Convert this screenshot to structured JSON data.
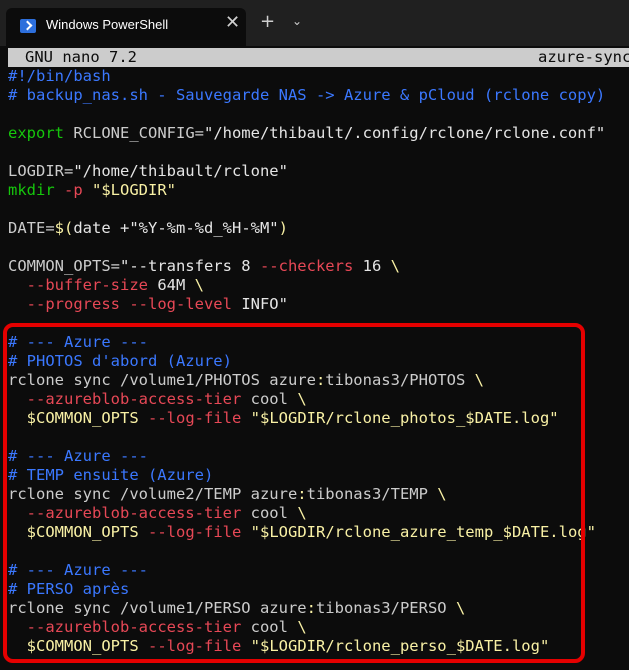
{
  "window": {
    "tab_title": "Windows PowerShell",
    "tab_close": "✕",
    "new_tab": "+",
    "dropdown": "⌄"
  },
  "nano": {
    "app_version": "GNU nano 7.2",
    "file_name": "azure-sync"
  },
  "code_lines": [
    [
      {
        "t": "#!/bin/bash",
        "c": "cmt"
      }
    ],
    [
      {
        "t": "# backup_nas.sh - Sauvegarde NAS -> Azure & pCloud (rclone copy)",
        "c": "cmt"
      }
    ],
    [],
    [
      {
        "t": "export",
        "c": "kw"
      },
      {
        "t": " RCLONE_CONFIG=",
        "c": "plain"
      },
      {
        "t": "\"/home/thibault/.config/rclone/rclone.conf\"",
        "c": "str"
      }
    ],
    [],
    [
      {
        "t": "LOGDIR=",
        "c": "plain"
      },
      {
        "t": "\"/home/thibault/rclone\"",
        "c": "str"
      }
    ],
    [
      {
        "t": "mkdir",
        "c": "kw"
      },
      {
        "t": " ",
        "c": "plain"
      },
      {
        "t": "-p",
        "c": "flag"
      },
      {
        "t": " \"$LOGDIR\"",
        "c": "var"
      }
    ],
    [],
    [
      {
        "t": "DATE=",
        "c": "plain"
      },
      {
        "t": "$(",
        "c": "op"
      },
      {
        "t": "date +\"%Y-%m-%d_%H-%M\"",
        "c": "str"
      },
      {
        "t": ")",
        "c": "op"
      }
    ],
    [],
    [
      {
        "t": "COMMON_OPTS=",
        "c": "plain"
      },
      {
        "t": "\"--transfers 8 ",
        "c": "str"
      },
      {
        "t": "--checkers",
        "c": "flag"
      },
      {
        "t": " 16 ",
        "c": "str"
      },
      {
        "t": "\\",
        "c": "var"
      }
    ],
    [
      {
        "t": "  ",
        "c": "plain"
      },
      {
        "t": "--buffer-size",
        "c": "flag"
      },
      {
        "t": " 64M ",
        "c": "str"
      },
      {
        "t": "\\",
        "c": "var"
      }
    ],
    [
      {
        "t": "  ",
        "c": "plain"
      },
      {
        "t": "--progress --log-level",
        "c": "flag"
      },
      {
        "t": " INFO\"",
        "c": "str"
      }
    ],
    [],
    [
      {
        "t": "# --- Azure ---",
        "c": "cmt"
      }
    ],
    [
      {
        "t": "# PHOTOS d'abord (Azure)",
        "c": "cmt"
      }
    ],
    [
      {
        "t": "rclone sync /volume1/PHOTOS azure",
        "c": "plain"
      },
      {
        "t": ":",
        "c": "var"
      },
      {
        "t": "tibonas3/PHOTOS ",
        "c": "plain"
      },
      {
        "t": "\\",
        "c": "var"
      }
    ],
    [
      {
        "t": "  ",
        "c": "plain"
      },
      {
        "t": "--azureblob-access-tier",
        "c": "flag"
      },
      {
        "t": " cool ",
        "c": "plain"
      },
      {
        "t": "\\",
        "c": "var"
      }
    ],
    [
      {
        "t": "  ",
        "c": "plain"
      },
      {
        "t": "$COMMON_OPTS",
        "c": "var"
      },
      {
        "t": " ",
        "c": "plain"
      },
      {
        "t": "--log-file",
        "c": "flag"
      },
      {
        "t": " \"$LOGDIR/rclone_photos_$DATE.log\"",
        "c": "var"
      }
    ],
    [],
    [
      {
        "t": "# --- Azure ---",
        "c": "cmt"
      }
    ],
    [
      {
        "t": "# TEMP ensuite (Azure)",
        "c": "cmt"
      }
    ],
    [
      {
        "t": "rclone sync /volume2/TEMP azure",
        "c": "plain"
      },
      {
        "t": ":",
        "c": "var"
      },
      {
        "t": "tibonas3/TEMP ",
        "c": "plain"
      },
      {
        "t": "\\",
        "c": "var"
      }
    ],
    [
      {
        "t": "  ",
        "c": "plain"
      },
      {
        "t": "--azureblob-access-tier",
        "c": "flag"
      },
      {
        "t": " cool ",
        "c": "plain"
      },
      {
        "t": "\\",
        "c": "var"
      }
    ],
    [
      {
        "t": "  ",
        "c": "plain"
      },
      {
        "t": "$COMMON_OPTS",
        "c": "var"
      },
      {
        "t": " ",
        "c": "plain"
      },
      {
        "t": "--log-file",
        "c": "flag"
      },
      {
        "t": " \"$LOGDIR/rclone_azure_temp_$DATE.log\"",
        "c": "var"
      }
    ],
    [],
    [
      {
        "t": "# --- Azure ---",
        "c": "cmt"
      }
    ],
    [
      {
        "t": "# PERSO après",
        "c": "cmt"
      }
    ],
    [
      {
        "t": "rclone sync /volume1/PERSO azure",
        "c": "plain"
      },
      {
        "t": ":",
        "c": "var"
      },
      {
        "t": "tibonas3/PERSO ",
        "c": "plain"
      },
      {
        "t": "\\",
        "c": "var"
      }
    ],
    [
      {
        "t": "  ",
        "c": "plain"
      },
      {
        "t": "--azureblob-access-tier",
        "c": "flag"
      },
      {
        "t": " cool ",
        "c": "plain"
      },
      {
        "t": "\\",
        "c": "var"
      }
    ],
    [
      {
        "t": "  ",
        "c": "plain"
      },
      {
        "t": "$COMMON_OPTS",
        "c": "var"
      },
      {
        "t": " ",
        "c": "plain"
      },
      {
        "t": "--log-file",
        "c": "flag"
      },
      {
        "t": " \"$LOGDIR/rclone_perso_$DATE.log\"",
        "c": "var"
      }
    ]
  ]
}
